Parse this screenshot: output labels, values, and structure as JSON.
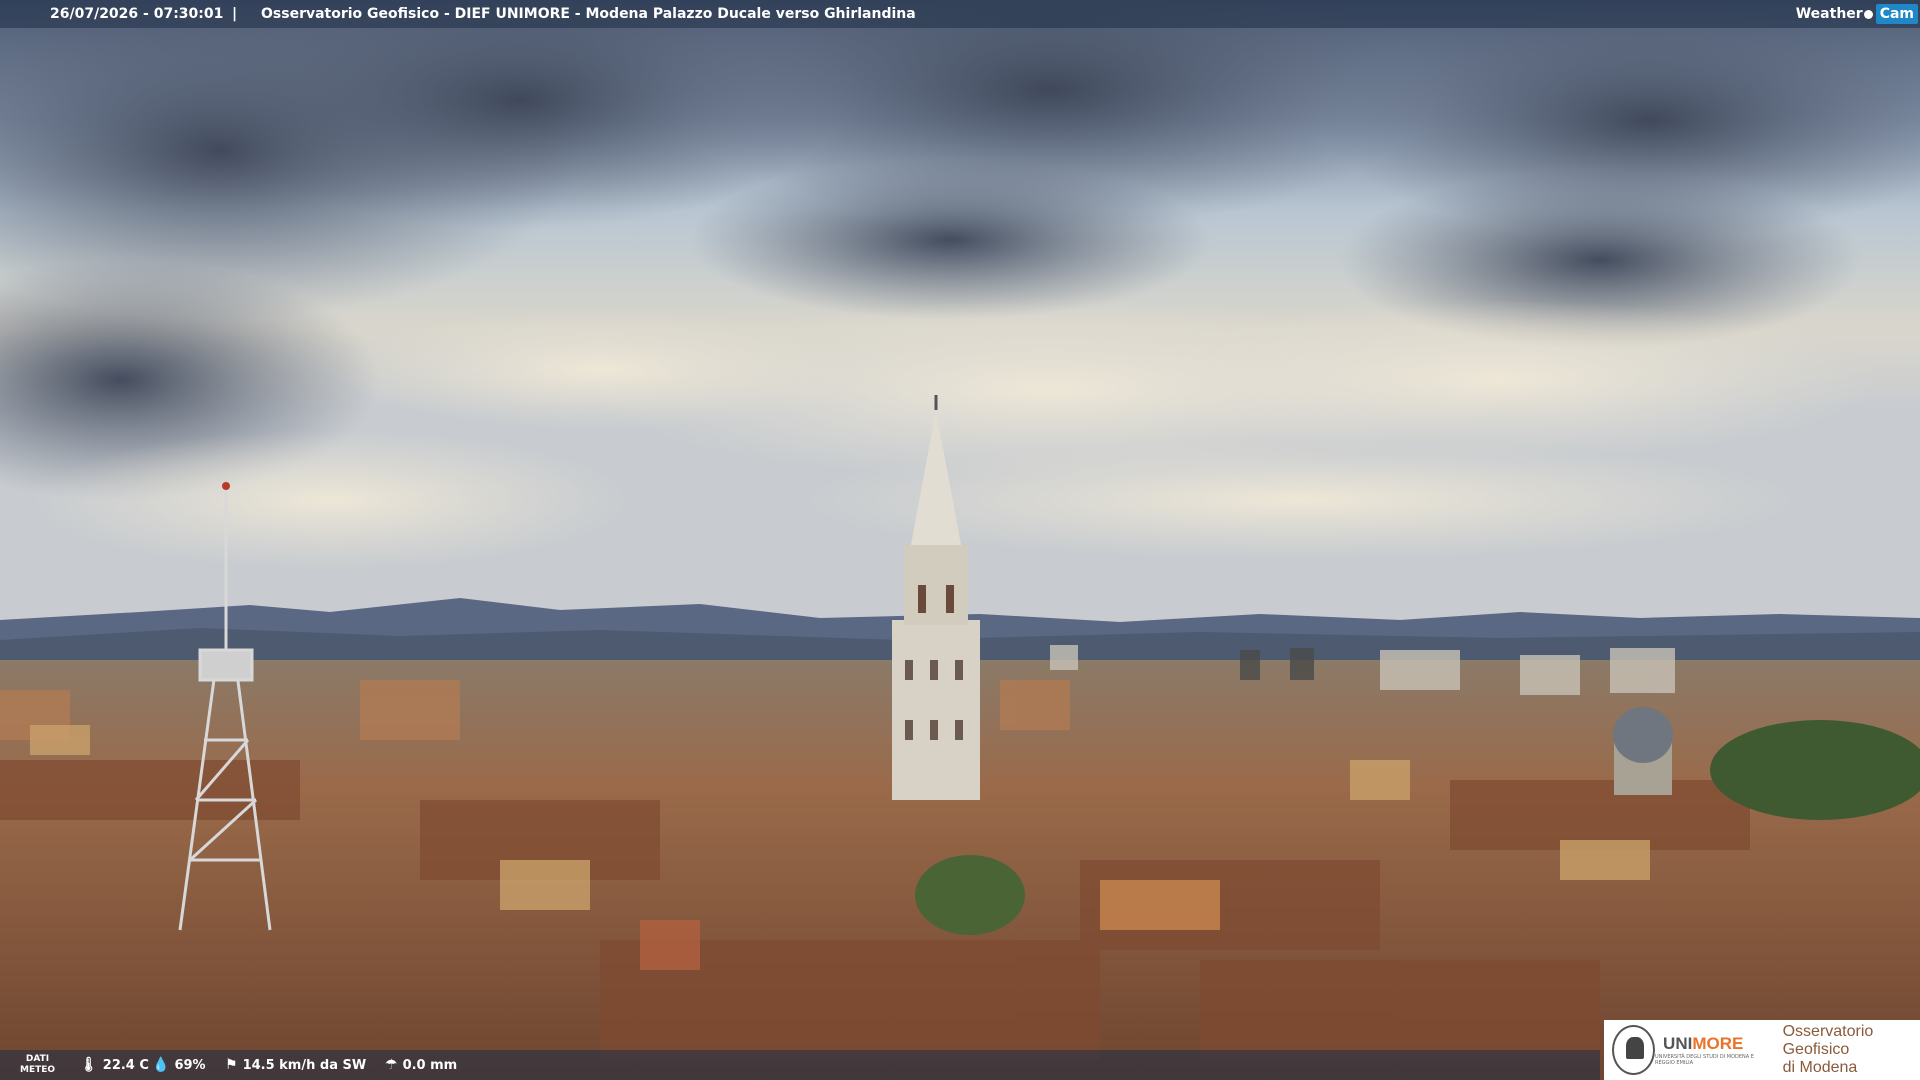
{
  "header": {
    "timestamp": "26/07/2026 - 07:30:01",
    "separator": "|",
    "title": "Osservatorio Geofisico - DIEF UNIMORE - Modena Palazzo Ducale verso Ghirlandina",
    "logo_weather": "Weather",
    "logo_cam": "Cam"
  },
  "footer": {
    "dati_line1": "DATI",
    "dati_line2": "METEO",
    "temperature": "22.4 C",
    "humidity": "69%",
    "wind": "14.5 km/h da SW",
    "rain": "0.0 mm",
    "icons": [
      "thermometer-icon",
      "humidity-drop-icon",
      "wind-icon",
      "rain-icon"
    ]
  },
  "badge": {
    "uni_1": "UNI",
    "uni_2": "MORE",
    "uni_sub": "UNIVERSITÀ DEGLI STUDI DI MODENA E REGGIO EMILIA",
    "obs_line1": "Osservatorio Geofisico",
    "obs_line2": "di Modena"
  },
  "colors": {
    "sky_top": "#5b6b85",
    "sky_mid": "#c9d4dc",
    "cloud_light": "#e9e2d2",
    "roof": "#9a5a3c",
    "tower": "#d8d2c6",
    "mountains": "#56657e",
    "accent": "#1e88c8",
    "unimore_orange": "#e8742a"
  }
}
